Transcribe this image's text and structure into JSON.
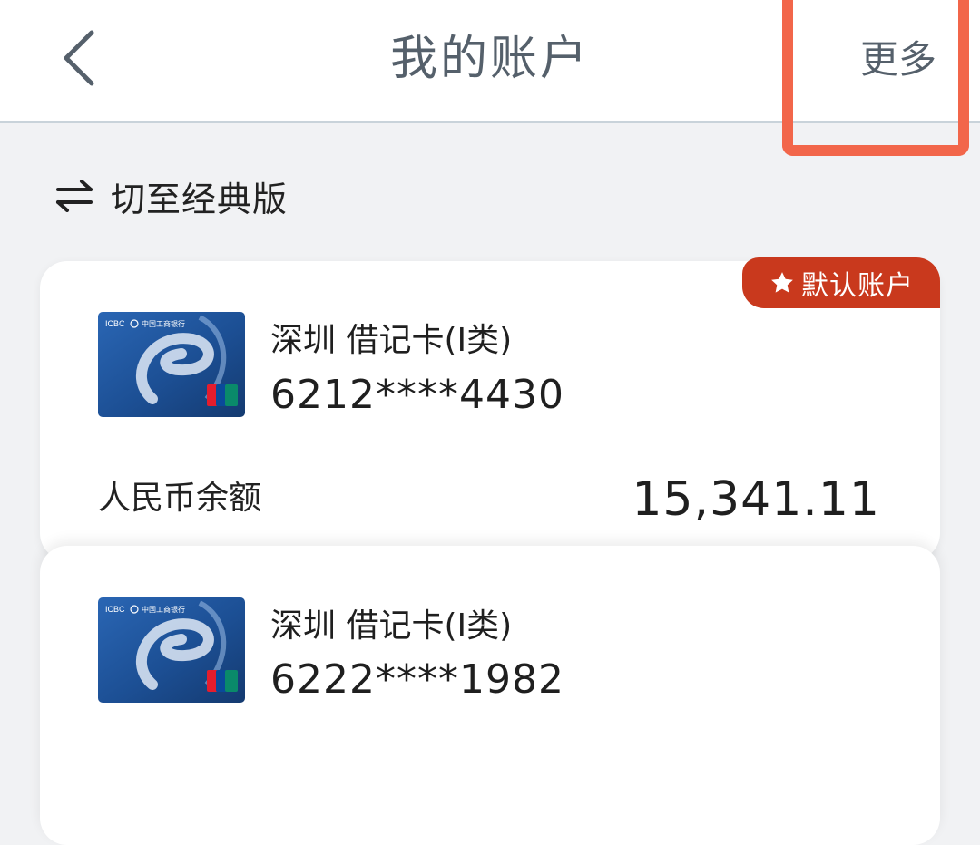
{
  "header": {
    "title": "我的账户",
    "more_label": "更多"
  },
  "switch": {
    "label": "切至经典版"
  },
  "accounts": [
    {
      "name": "深圳 借记卡(I类)",
      "number": "6212****4430",
      "default_badge": "默认账户",
      "balance_label": "人民币余额",
      "balance": "15,341.11"
    },
    {
      "name": "深圳 借记卡(I类)",
      "number": "6222****1982"
    }
  ],
  "card_image": {
    "brand": "ICBC",
    "bank_name": "中国工商银行",
    "network": "UnionPay 银联"
  },
  "colors": {
    "highlight": "#f2664a",
    "badge": "#c9391d",
    "header_text": "#55606b",
    "card_blue": "#1c4f94"
  },
  "icons": {
    "back": "chevron-left-icon",
    "switch": "switch-arrows-icon",
    "badge": "star-icon"
  }
}
